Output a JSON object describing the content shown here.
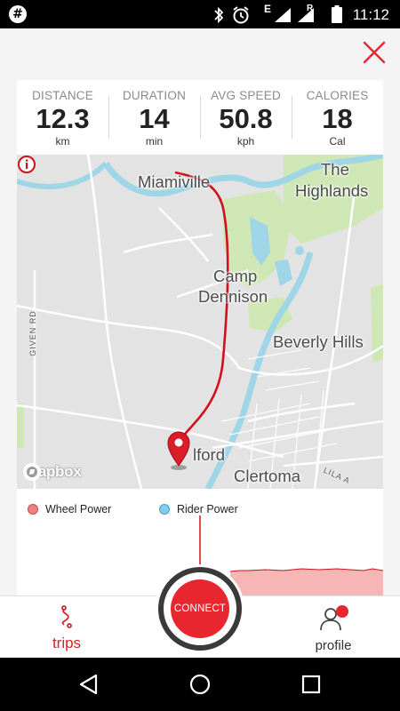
{
  "status_bar": {
    "time": "11:12",
    "network_letter_e": "E",
    "network_letter_r": "R",
    "icons": [
      "app-hash-icon",
      "bluetooth-icon",
      "alarm-icon",
      "signal-icon",
      "signal-roaming-icon",
      "battery-icon"
    ]
  },
  "stats": [
    {
      "label": "DISTANCE",
      "value": "12.3",
      "unit": "km"
    },
    {
      "label": "DURATION",
      "value": "14",
      "unit": "min"
    },
    {
      "label": "AVG SPEED",
      "value": "50.8",
      "unit": "kph"
    },
    {
      "label": "CALORIES",
      "value": "18",
      "unit": "Cal"
    }
  ],
  "map": {
    "places": {
      "miamiville": "Miamiville",
      "the": "The",
      "highlands": "Highlands",
      "camp": "Camp",
      "dennison": "Dennison",
      "beverly_hills": "Beverly Hills",
      "milford": "lford",
      "clertoma": "Clertoma"
    },
    "roads": {
      "given_rd": "GIVEN RD",
      "lila_a": "LILA A"
    },
    "attribution": "mapbox",
    "route_color": "#d0101a"
  },
  "chart": {
    "legend": [
      {
        "label": "Wheel Power",
        "color": "#f08080"
      },
      {
        "label": "Rider Power",
        "color": "#7fcdf0"
      }
    ]
  },
  "bottom_nav": {
    "trips_label": "trips",
    "profile_label": "profile",
    "connect_label": "CONNECT",
    "accent": "#d2222a"
  },
  "colors": {
    "brand_red": "#e8262f"
  }
}
